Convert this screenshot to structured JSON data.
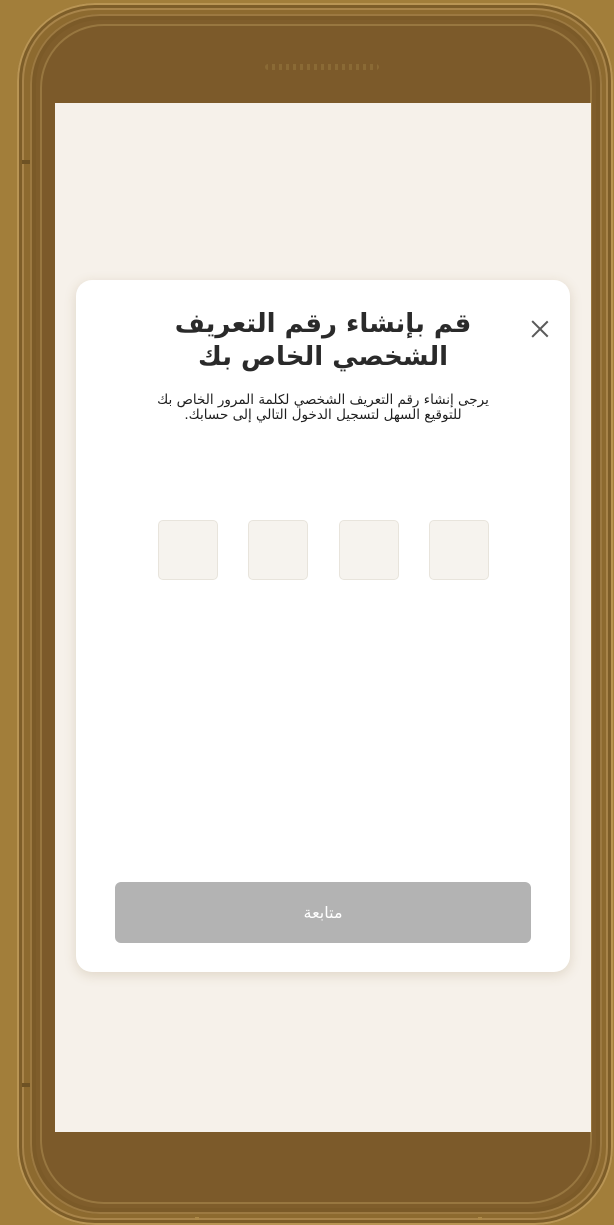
{
  "dialog": {
    "title_line1": "قم بإنشاء رقم التعريف",
    "title_line2": "الشخصي الخاص بك",
    "subtitle_line1": "يرجى إنشاء رقم التعريف الشخصي لكلمة المرور الخاص بك",
    "subtitle_line2": "للتوقيع السهل لتسجيل الدخول التالي إلى حسابك.",
    "pin_length": 4,
    "pin_values": [
      "",
      "",
      "",
      ""
    ],
    "continue_label": "متابعة",
    "continue_enabled": false
  },
  "colors": {
    "background": "#a27e3a",
    "frame": "#7c5a2a",
    "screen": "#f6f1ea",
    "card": "#ffffff",
    "button_disabled": "#b3b3b3",
    "pin_box": "#f6f3ee"
  },
  "icons": {
    "close": "close-icon"
  }
}
